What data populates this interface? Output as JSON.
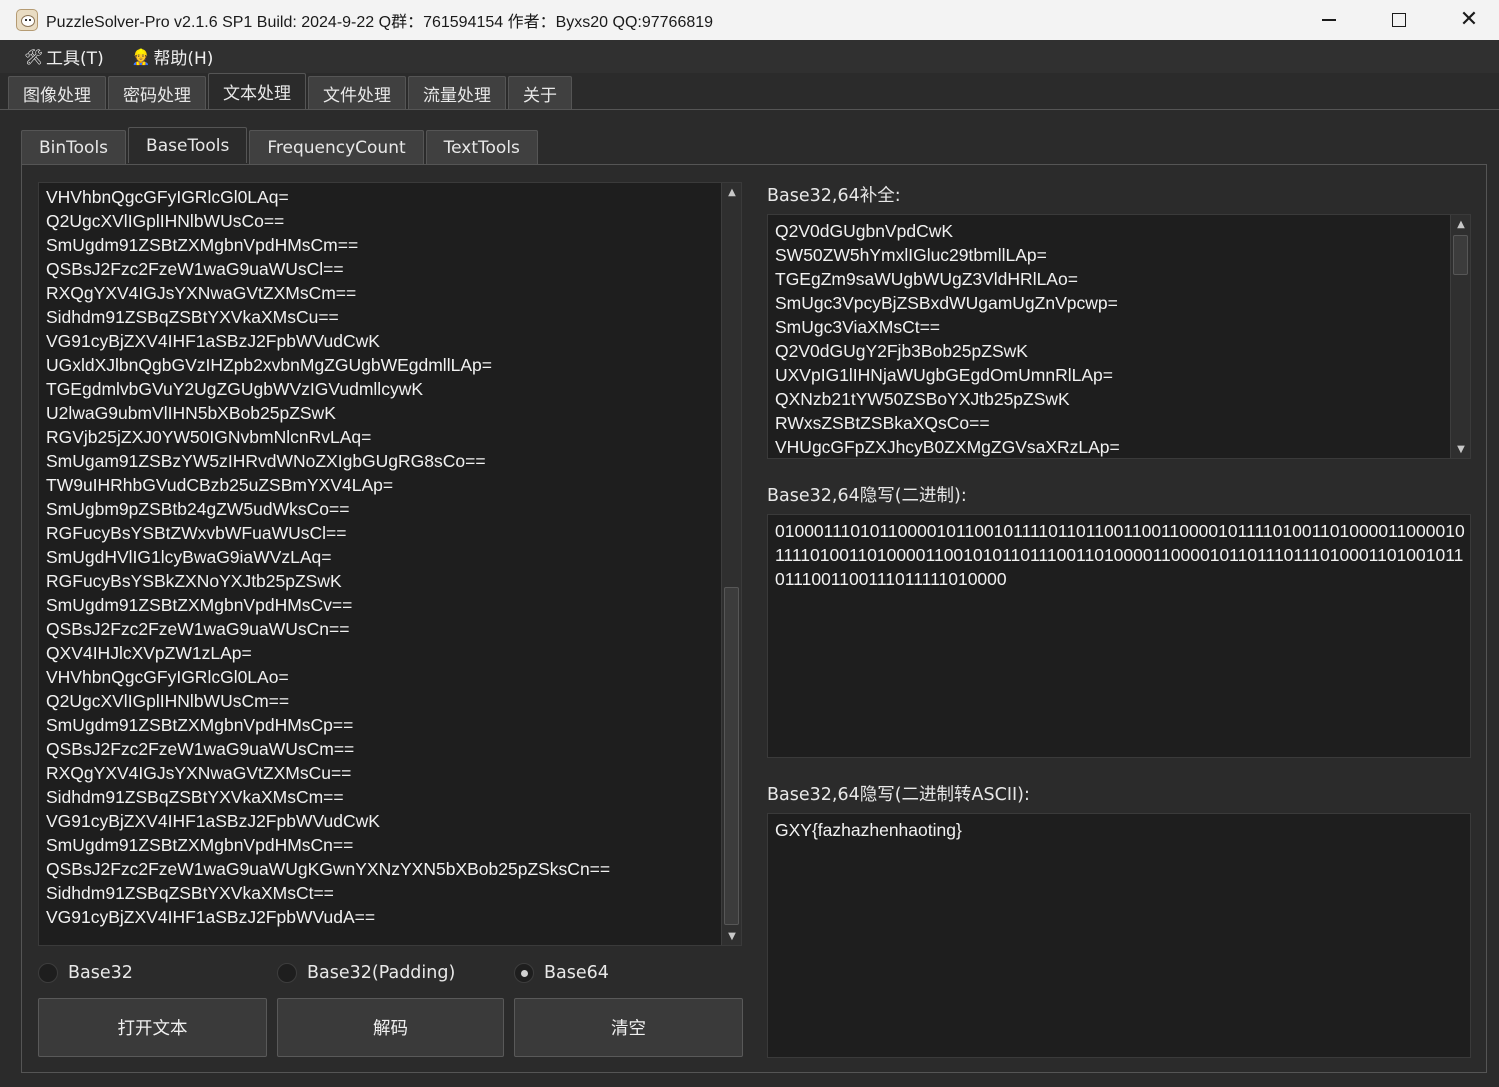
{
  "window": {
    "title": "PuzzleSolver-Pro v2.1.6 SP1  Build: 2024-9-22  Q群：761594154  作者：Byxs20  QQ:97766819"
  },
  "menu": {
    "tools": "工具(T)",
    "help": "帮助(H)"
  },
  "top_tabs": [
    "图像处理",
    "密码处理",
    "文本处理",
    "文件处理",
    "流量处理",
    "关于"
  ],
  "top_tab_active": "文本处理",
  "sub_tabs": [
    "BinTools",
    "BaseTools",
    "FrequencyCount",
    "TextTools"
  ],
  "sub_tab_active": "BaseTools",
  "input_lines": [
    "VHVhbnQgcGFyIGRlcGl0LAq=",
    "Q2UgcXVlIGplIHNlbWUsCo==",
    "SmUgdm91ZSBtZXMgbnVpdHMsCm==",
    "QSBsJ2Fzc2FzeW1waG9uaWUsCl==",
    "RXQgYXV4IGJsYXNwaGVtZXMsCm==",
    "Sidhdm91ZSBqZSBtYXVkaXMsCu==",
    "VG91cyBjZXV4IHF1aSBzJ2FpbWVudCwK",
    "UGxldXJlbnQgbGVzIHZpb2xvbnMgZGUgbWEgdmllLAp=",
    "TGEgdmlvbGVuY2UgZGUgbWVzIGVudmllcywK",
    "U2lwaG9ubmVlIHN5bXBob25pZSwK",
    "RGVjb25jZXJ0YW50IGNvbmNlcnRvLAq=",
    "SmUgam91ZSBzYW5zIHRvdWNoZXIgbGUgRG8sCo==",
    "TW9uIHRhbGVudCBzb25uZSBmYXV4LAp=",
    "SmUgbm9pZSBtb24gZW5udWksCo==",
    "RGFucyBsYSBtZWxvbWFuaWUsCl==",
    "SmUgdHVlIG1lcyBwaG9iaWVzLAq=",
    "RGFucyBsYSBkZXNoYXJtb25pZSwK",
    "SmUgdm91ZSBtZXMgbnVpdHMsCv==",
    "QSBsJ2Fzc2FzeW1waG9uaWUsCn==",
    "QXV4IHJlcXVpZW1zLAp=",
    "VHVhbnQgcGFyIGRlcGl0LAo=",
    "Q2UgcXVlIGplIHNlbWUsCm==",
    "SmUgdm91ZSBtZXMgbnVpdHMsCp==",
    "QSBsJ2Fzc2FzeW1waG9uaWUsCm==",
    "RXQgYXV4IGJsYXNwaGVtZXMsCu==",
    "Sidhdm91ZSBqZSBtYXVkaXMsCm==",
    "VG91cyBjZXV4IHF1aSBzJ2FpbWVudCwK",
    "SmUgdm91ZSBtZXMgbnVpdHMsCn==",
    "QSBsJ2Fzc2FzeW1waG9uaWUgKGwnYXNzYXN5bXBob25pZSksCn==",
    "Sidhdm91ZSBqZSBtYXVkaXMsCt==",
    "VG91cyBjZXV4IHF1aSBzJ2FpbWVudA=="
  ],
  "radios": {
    "base32": "Base32",
    "base32_padding": "Base32(Padding)",
    "base64": "Base64",
    "selected": "base64"
  },
  "buttons": {
    "open": "打开文本",
    "decode": "解码",
    "clear": "清空"
  },
  "padded": {
    "label": "Base32,64补全:",
    "lines": [
      "Q2V0dGUgbnVpdCwK",
      "SW50ZW5hYmxlIGluc29tbmllLAp=",
      "TGEgZm9saWUgbWUgZ3VldHRlLAo=",
      "SmUgc3VpcyBjZSBxdWUgamUgZnVpcwp=",
      "SmUgc3ViaXMsCt==",
      "Q2V0dGUgY2Fjb3Bob25pZSwK",
      "UXVpIG1lIHNjaWUgbGEgdOmUmnRlLAp=",
      "QXNzb21tYW50ZSBoYXJtb25pZSwK",
      "RWxsZSBtZSBkaXQsCo==",
      "VHUgcGFpZXJhcyB0ZXMgZGVsaXRzLAp="
    ]
  },
  "stego_bin": {
    "label": "Base32,64隐写(二进制):",
    "value": "010001110101100001011001011110110110011001100001011110100110100001100001011110100110100001100101011011100110100001100001011011101110100011010010110111001100111011111010000"
  },
  "stego_ascii": {
    "label": "Base32,64隐写(二进制转ASCII):",
    "value": "GXY{fazhazhenhaoting}"
  }
}
